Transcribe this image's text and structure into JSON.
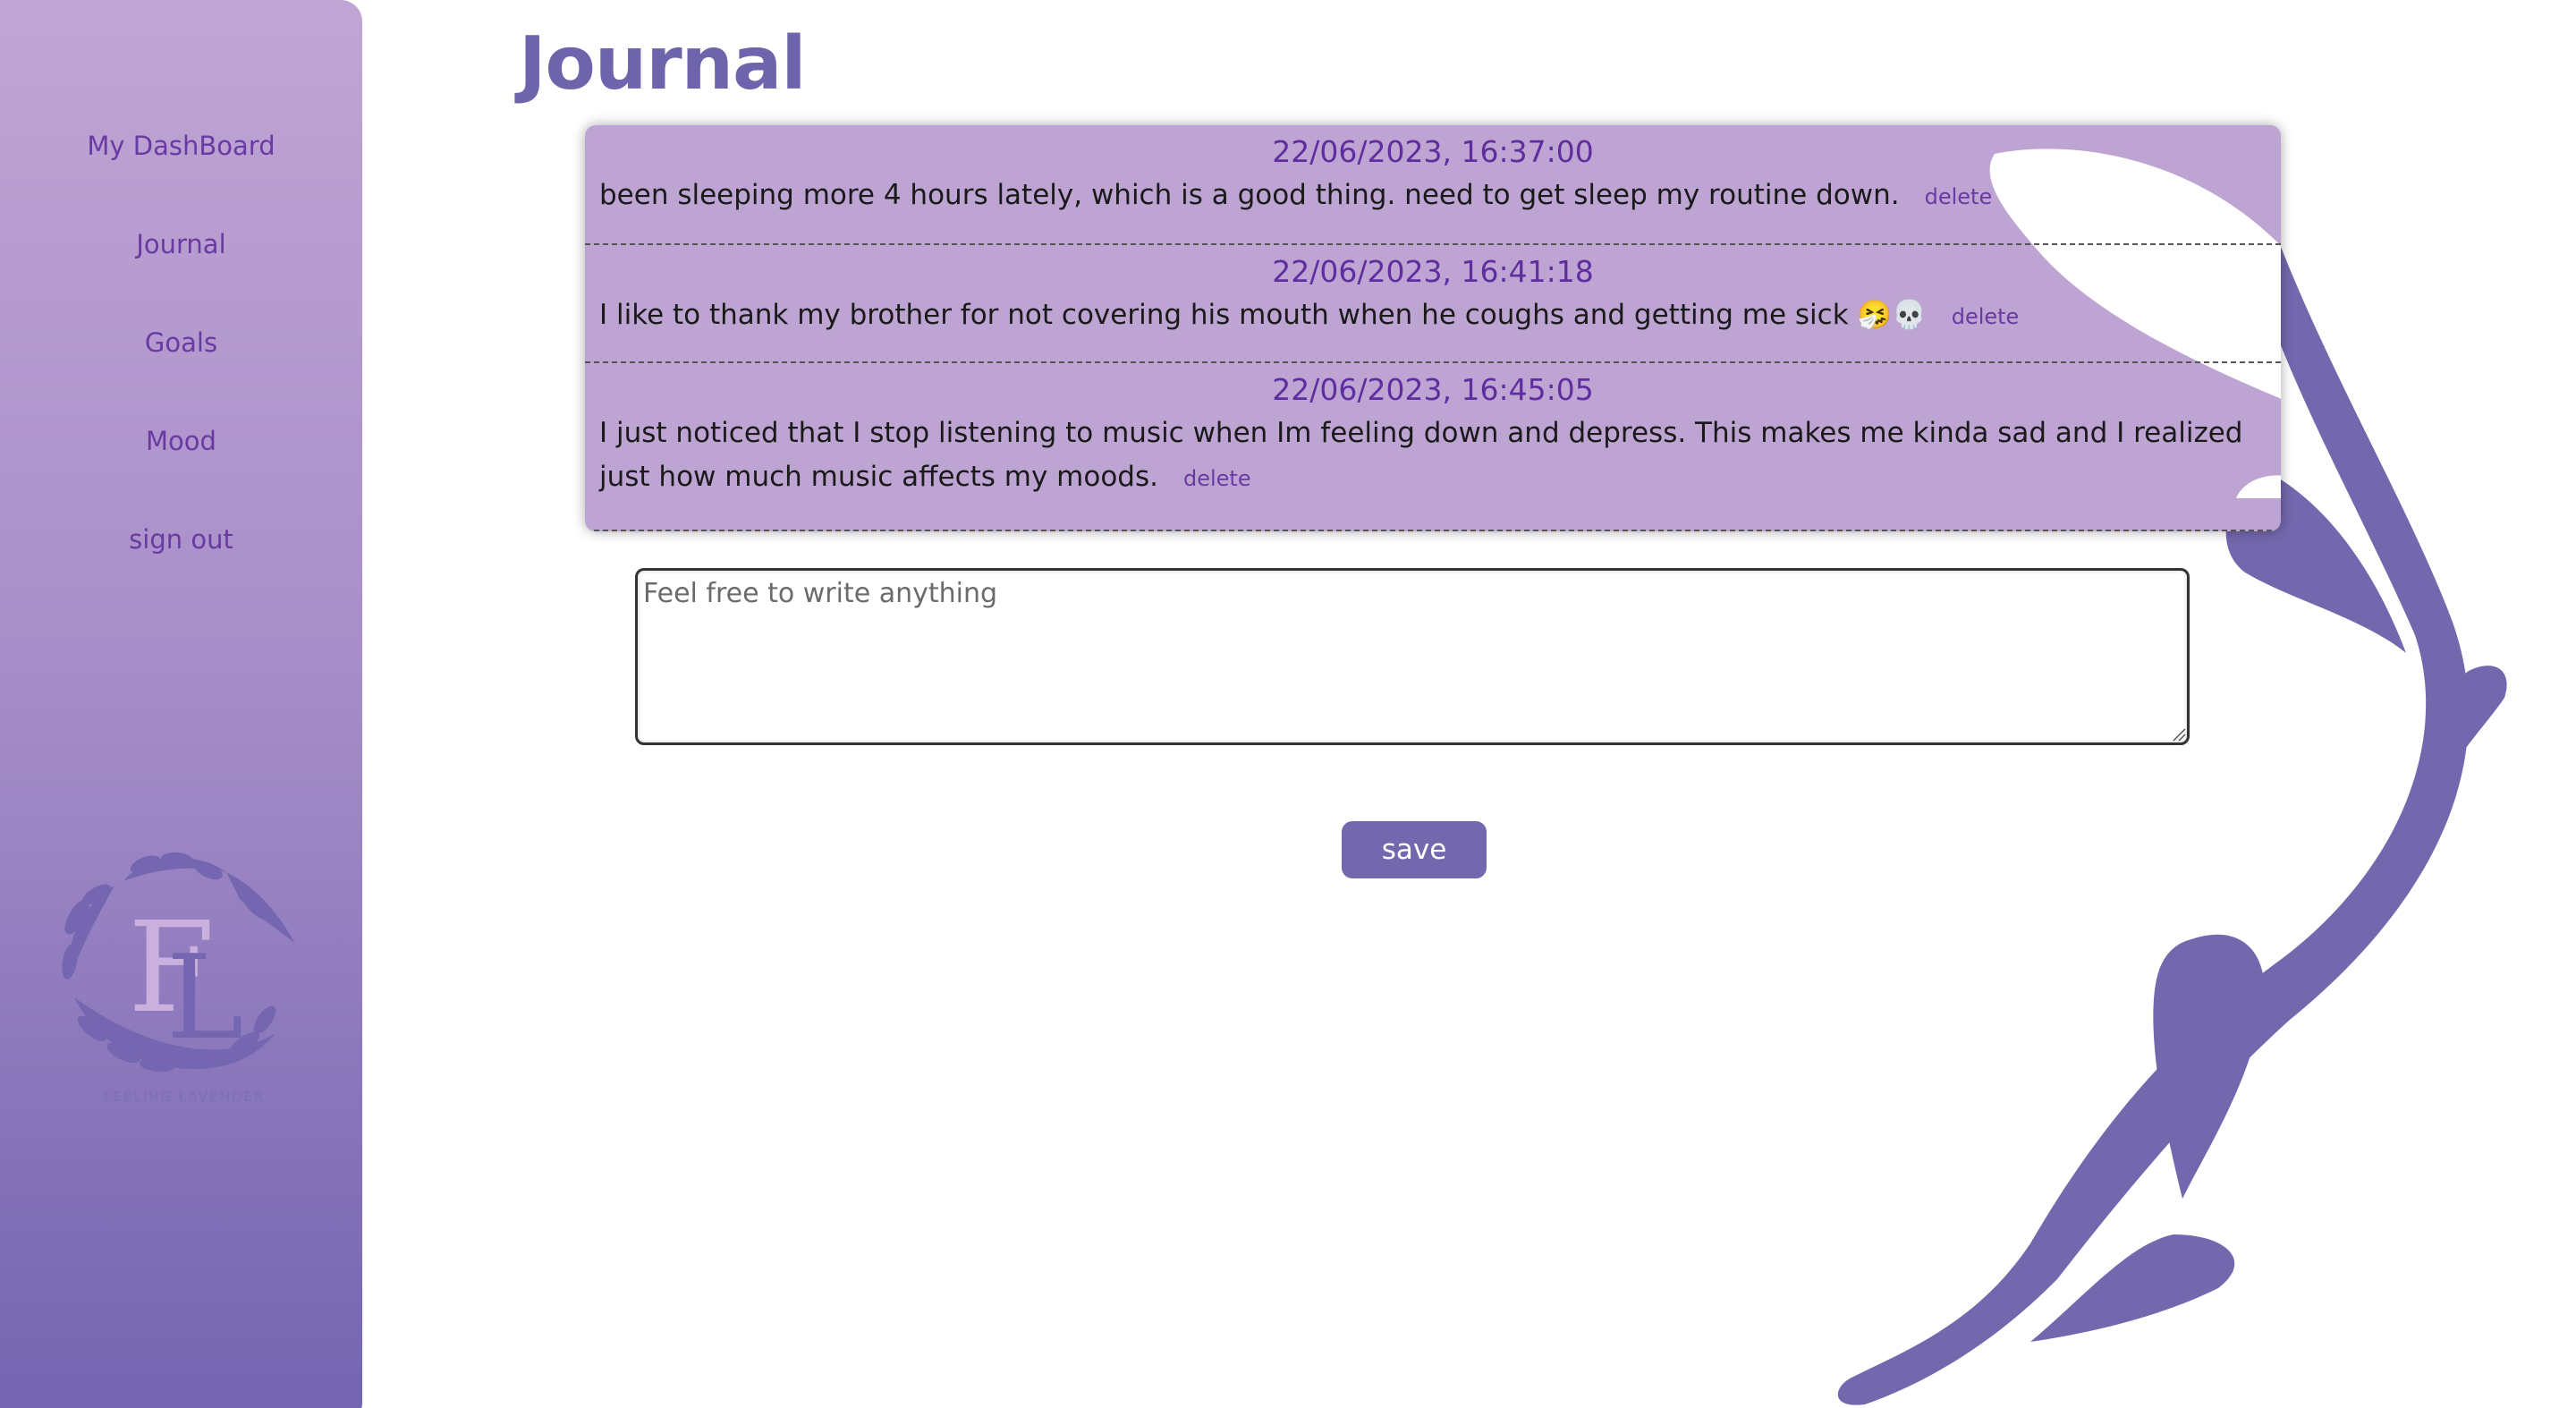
{
  "sidebar": {
    "items": [
      {
        "label": "My DashBoard"
      },
      {
        "label": "Journal"
      },
      {
        "label": "Goals"
      },
      {
        "label": "Mood"
      },
      {
        "label": "sign out"
      }
    ],
    "logo": {
      "monogram": "FL",
      "caption": "FEELING LAVENDER"
    }
  },
  "page": {
    "title": "Journal"
  },
  "entries": [
    {
      "date": "22/06/2023, 16:37:00",
      "text": "been sleeping more 4 hours lately, which is a good thing. need to get sleep my routine down.",
      "delete_label": "delete"
    },
    {
      "date": "22/06/2023, 16:41:18",
      "text": "I like to thank my brother for not covering his mouth when he coughs and getting me sick 🤧💀",
      "delete_label": "delete"
    },
    {
      "date": "22/06/2023, 16:45:05",
      "text": "I just noticed that I stop listening to music when Im feeling down and depress. This makes me kinda sad and I realized just how much music affects my moods.",
      "delete_label": "delete"
    }
  ],
  "composer": {
    "placeholder": "Feel free to write anything",
    "value": ""
  },
  "actions": {
    "save_label": "save"
  },
  "colors": {
    "accent": "#7368ae",
    "entries_bg": "#bda4d3",
    "link": "#6a3aa3",
    "sidebar_top": "#c0a5d4",
    "sidebar_bottom": "#7264b0"
  }
}
